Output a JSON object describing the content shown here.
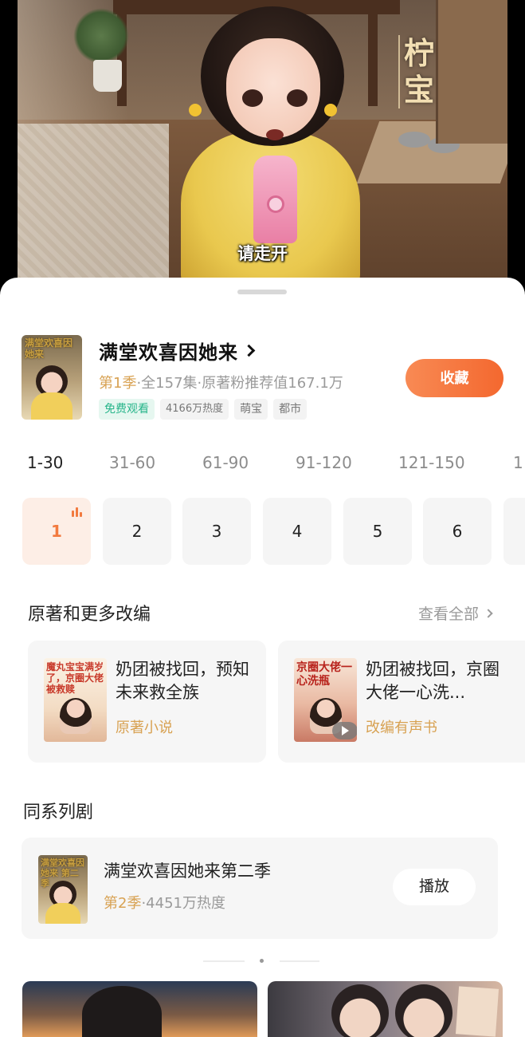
{
  "video": {
    "watermark": "柠宝",
    "subtitle": "请走开"
  },
  "drama": {
    "title": "满堂欢喜因她来",
    "cover_text": "满堂欢喜因她来",
    "season": "第1季",
    "meta_rest": "·全157集·原著粉推荐值167.1万",
    "tags": [
      "免费观看",
      "4166万热度",
      "萌宝",
      "都市"
    ],
    "favorite_label": "收藏"
  },
  "ranges": [
    "1-30",
    "31-60",
    "61-90",
    "91-120",
    "121-150",
    "1"
  ],
  "episodes": [
    "1",
    "2",
    "3",
    "4",
    "5",
    "6"
  ],
  "adaptations": {
    "title": "原著和更多改编",
    "see_all": "查看全部",
    "items": [
      {
        "name": "奶团被找回，预知未来救全族",
        "type": "原著小说",
        "cover_text": "魔丸宝宝满岁了，京圈大佬被救赎"
      },
      {
        "name": "奶团被找回，京圈大佬一心洗...",
        "type": "改编有声书",
        "cover_text": "京圈大佬一心洗瓶"
      }
    ]
  },
  "series": {
    "title": "同系列剧",
    "name": "满堂欢喜因她来第二季",
    "season": "第2季",
    "meta_rest": "·4451万热度",
    "play_label": "播放",
    "cover_text": "满堂欢喜因她来 第二季"
  },
  "colors": {
    "accent": "#F4682F",
    "gold": "#D8A253",
    "free_tag": "#27B58A"
  }
}
